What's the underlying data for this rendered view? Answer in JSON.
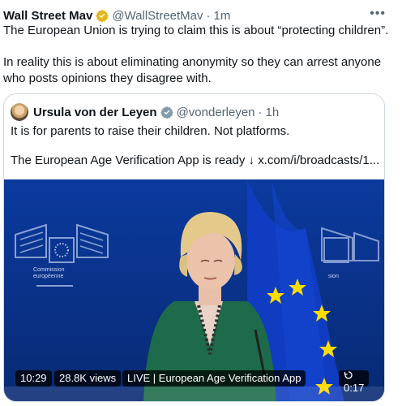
{
  "post": {
    "author_name": "Wall Street Mav",
    "handle": "@WallStreetMav",
    "separator": "·",
    "time": "1m",
    "more_label": "•••",
    "text_line1": "The European Union is trying to claim this is about “protecting children”.",
    "text_line2": "In reality this is about eliminating anonymity so they can arrest anyone who posts opinions they disagree with."
  },
  "quote": {
    "author_name": "Ursula von der Leyen",
    "handle": "@vonderleyen",
    "separator": "·",
    "time": "1h",
    "text_line1": "It is for parents to raise their children. Not platforms.",
    "text_line2": "The European Age Verification App is ready ↓ x.com/i/broadcasts/1..."
  },
  "video": {
    "time": "10:29",
    "views": "28.8K views",
    "live_title": "LIVE | European Age Verification App",
    "duration": "0:17",
    "backdrop_caption": "Commission européenne",
    "backdrop_caption_right": "sion"
  },
  "colors": {
    "verified_gold": "#e2b719",
    "verified_gray": "#829aab",
    "eu_blue": "#0d3aa3",
    "eu_star": "#ffdd00"
  }
}
